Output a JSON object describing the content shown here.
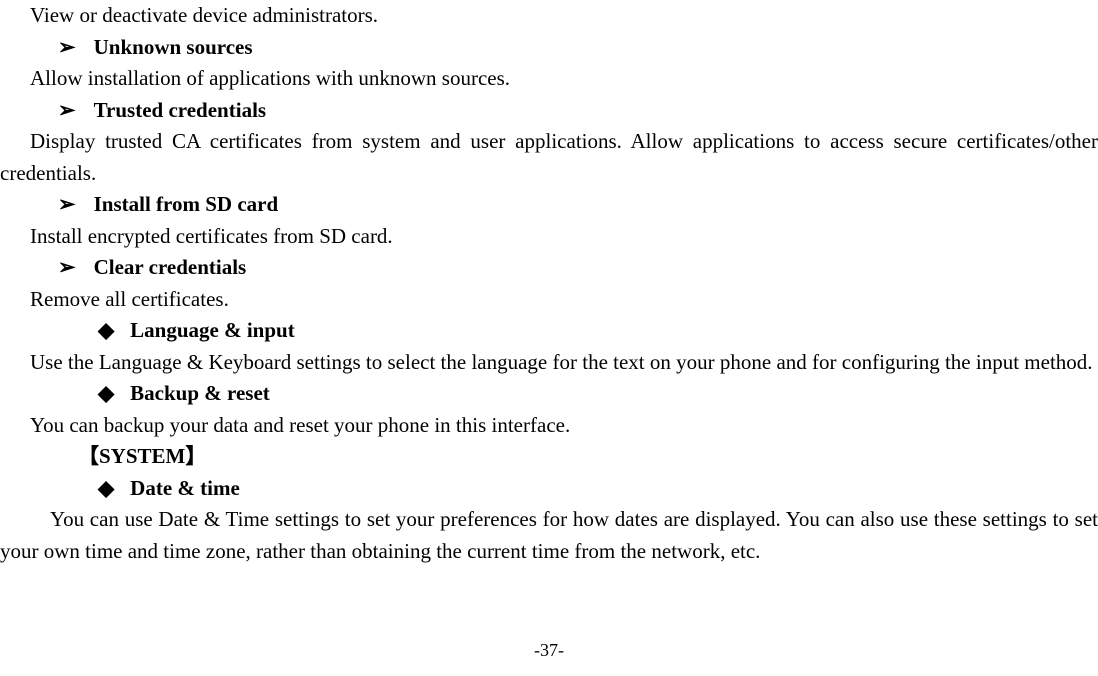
{
  "line1": "View or deactivate device administrators.",
  "bullet1_title": "Unknown sources",
  "line2": "Allow installation of applications with unknown sources.",
  "bullet2_title": "Trusted credentials",
  "line3": "Display trusted CA certificates from system and user applications. Allow applications to access secure certificates/other credentials.",
  "bullet3_title": "Install from SD card",
  "line4": "Install encrypted certificates from SD card.",
  "bullet4_title": "Clear credentials",
  "line5": "Remove all certificates.",
  "diamond1_title": "Language & input",
  "line6": "Use the Language & Keyboard settings to select the language for the text on your phone and for configuring the input method.",
  "diamond2_title": "Backup & reset",
  "line7": "You can backup your data and reset your phone in this interface.",
  "system_label": "【SYSTEM】",
  "diamond3_title": "Date & time",
  "line8": "You can use Date & Time settings to set your preferences for how dates are displayed. You can also use these settings to set your own time and time zone, rather than obtaining the current time from the network, etc.",
  "page_number": "-37-",
  "arrow_symbol": "➢",
  "diamond_symbol": "◆"
}
